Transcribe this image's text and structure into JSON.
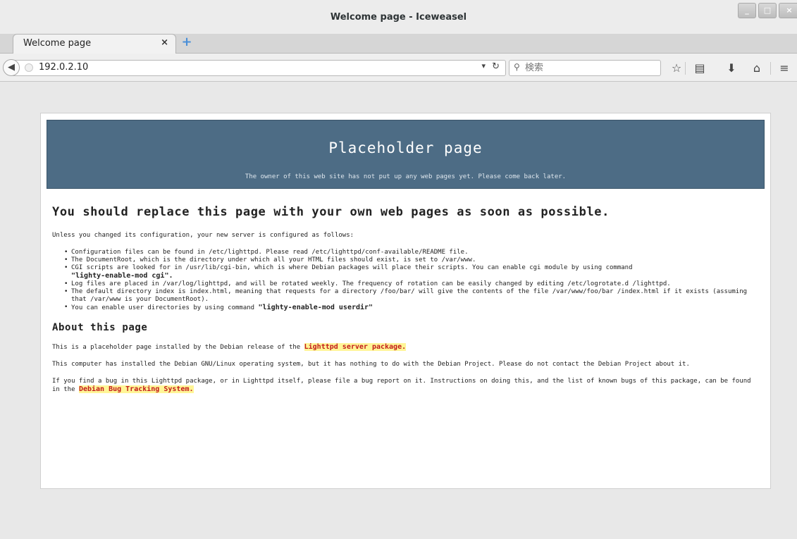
{
  "window": {
    "title": "Welcome page - Iceweasel",
    "min_glyph": "_",
    "max_glyph": "□",
    "close_glyph": "×"
  },
  "tabs": [
    {
      "label": "Welcome page",
      "close_glyph": "×"
    }
  ],
  "new_tab_glyph": "+",
  "navbar": {
    "back_glyph": "◀",
    "url": "192.0.2.10",
    "dropdown_glyph": "▾",
    "reload_glyph": "↻",
    "search_icon_glyph": "⚲",
    "search_placeholder": "検索",
    "star_glyph": "☆",
    "reader_glyph": "▤",
    "download_glyph": "⬇",
    "home_glyph": "⌂",
    "menu_glyph": "≡"
  },
  "page": {
    "banner_title": "Placeholder page",
    "banner_subtitle": "The owner of this web site has not put up any web pages yet. Please come back later.",
    "heading": "You should replace this page with your own web pages as soon as possible.",
    "intro": "Unless you changed its configuration, your new server is configured as follows:",
    "items": [
      {
        "text": "Configuration files can be found in /etc/lighttpd. Please read /etc/lighttpd/conf-available/README file.",
        "cmd": ""
      },
      {
        "text": "The DocumentRoot, which is the directory under which all your HTML files should exist, is set to /var/www.",
        "cmd": ""
      },
      {
        "text": "CGI scripts are looked for in /usr/lib/cgi-bin, which is where Debian packages will place their scripts. You can enable cgi module by using command ",
        "cmd": "\"lighty-enable-mod cgi\".",
        "cmd_break": true
      },
      {
        "text": "Log files are placed in /var/log/lighttpd, and will be rotated weekly. The frequency of rotation can be easily changed by editing /etc/logrotate.d /lighttpd.",
        "cmd": ""
      },
      {
        "text": "The default directory index is index.html, meaning that requests for a directory /foo/bar/ will give the contents of the file /var/www/foo/bar /index.html if it exists (assuming that /var/www is your DocumentRoot).",
        "cmd": ""
      },
      {
        "text": "You can enable user directories by using command ",
        "cmd": "\"lighty-enable-mod userdir\""
      }
    ],
    "about_heading": "About this page",
    "about_p1_text": "This is a placeholder page installed by the Debian release of the ",
    "about_p1_link": "Lighttpd server package.",
    "about_p2": "This computer has installed the Debian GNU/Linux operating system, but it has nothing to do with the Debian Project. Please do not contact the Debian Project about it.",
    "about_p3_text": "If you find a bug in this Lighttpd package, or in Lighttpd itself, please file a bug report on it. Instructions on doing this, and the list of known bugs of this package, can be found in the ",
    "about_p3_link": "Debian Bug Tracking System."
  }
}
